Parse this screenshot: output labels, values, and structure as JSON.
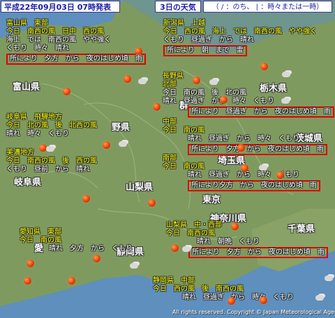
{
  "header": {
    "issued": "平成22年09月03日 07時発表",
    "day_title": "3日の天気",
    "legend": "（ / ：のち、 | ：時々または一時）"
  },
  "prefecture_labels": {
    "toyama": "富山県",
    "nagano": "長野県",
    "tochigi": "栃木県",
    "gunma": "群",
    "ibaraki": "茨城県",
    "saitama": "埼玉県",
    "yamanashi": "山梨県",
    "gifu": "岐阜県",
    "tokyo": "東京",
    "kanagawa": "神奈川県",
    "chiba": "千葉県",
    "aichi": "愛",
    "shizuoka": "静岡県",
    "nagano_kanji": "野県"
  },
  "forecasts": {
    "toyama_east": {
      "lines": [
        "富山県　東部",
        "今日　南西の風　日中　西の風",
        "海上　では　南西の風　やや強く",
        "くもり　時々　晴れ"
      ],
      "highlight": "所により　夕方　から　夜のはじめ頃　雨"
    },
    "niigata": {
      "lines": [
        "新潟県　上越",
        "今日　西の風　海上　では　南西の風　やや強く",
        "くもり　昼過ぎ　から　晴れ"
      ],
      "highlight": "所により　朝　まで　雷"
    },
    "nagano_north": {
      "lines": [
        "長野県",
        "北部",
        "今日　南の風　後　北の風",
        "晴れ　昼過ぎ　から　時々　くもり"
      ],
      "highlight": "所により　昼過ぎ　から　夜のはじめ頃　雨"
    },
    "gifu_hida": {
      "lines": [
        "岐阜県　飛騨地方",
        "今日　北の風　後　北西の風",
        "晴れ　時々　くもり"
      ]
    },
    "nagano_central": {
      "lines": [
        "中部",
        "今日　南の風",
        "晴れ　昼過ぎ　から　時々　くもり"
      ],
      "highlight": "所により　夕方　から　夜のはじめ頃　雨"
    },
    "gifu_mino": {
      "lines": [
        "美濃地方",
        "今日　南西の風　後　西の風",
        "くもり　昼前　から　晴れ"
      ]
    },
    "nagano_south": {
      "lines": [
        "南部",
        "今日　南の風",
        "晴れ　昼過ぎ　から　時々　くもり"
      ],
      "highlight": "所により夕方　から　夜のはじめ頃　雨"
    },
    "yamanashi": {
      "lines": [
        "山梨県　中・西部",
        "今日　南西の風",
        "晴れ　朝晩　くもり"
      ],
      "highlight": "所により　夕方　から　夜のはじめ頃　雨"
    },
    "aichi": {
      "lines": [
        "愛知県　東部",
        "今日　南の風",
        "晴れ　夕方　から　くもり"
      ]
    },
    "shizuoka": {
      "lines": [
        "静岡県　中部",
        "今日　西の風　後　南西の風",
        "晴れ　昼過ぎ　から　時々　くもり"
      ]
    }
  },
  "copyright": "All rights reserved. Copyright © Japan Meteorological Agency",
  "icons": {
    "sun": "sunny-weather-icon",
    "cloud": "cloudy-weather-icon"
  },
  "colors": {
    "land": "#7f9a5f",
    "sea": "#5e8fbd",
    "highlight_border": "#e00000",
    "title_text": "#ffff00",
    "header_text": "#1a1aa8"
  }
}
